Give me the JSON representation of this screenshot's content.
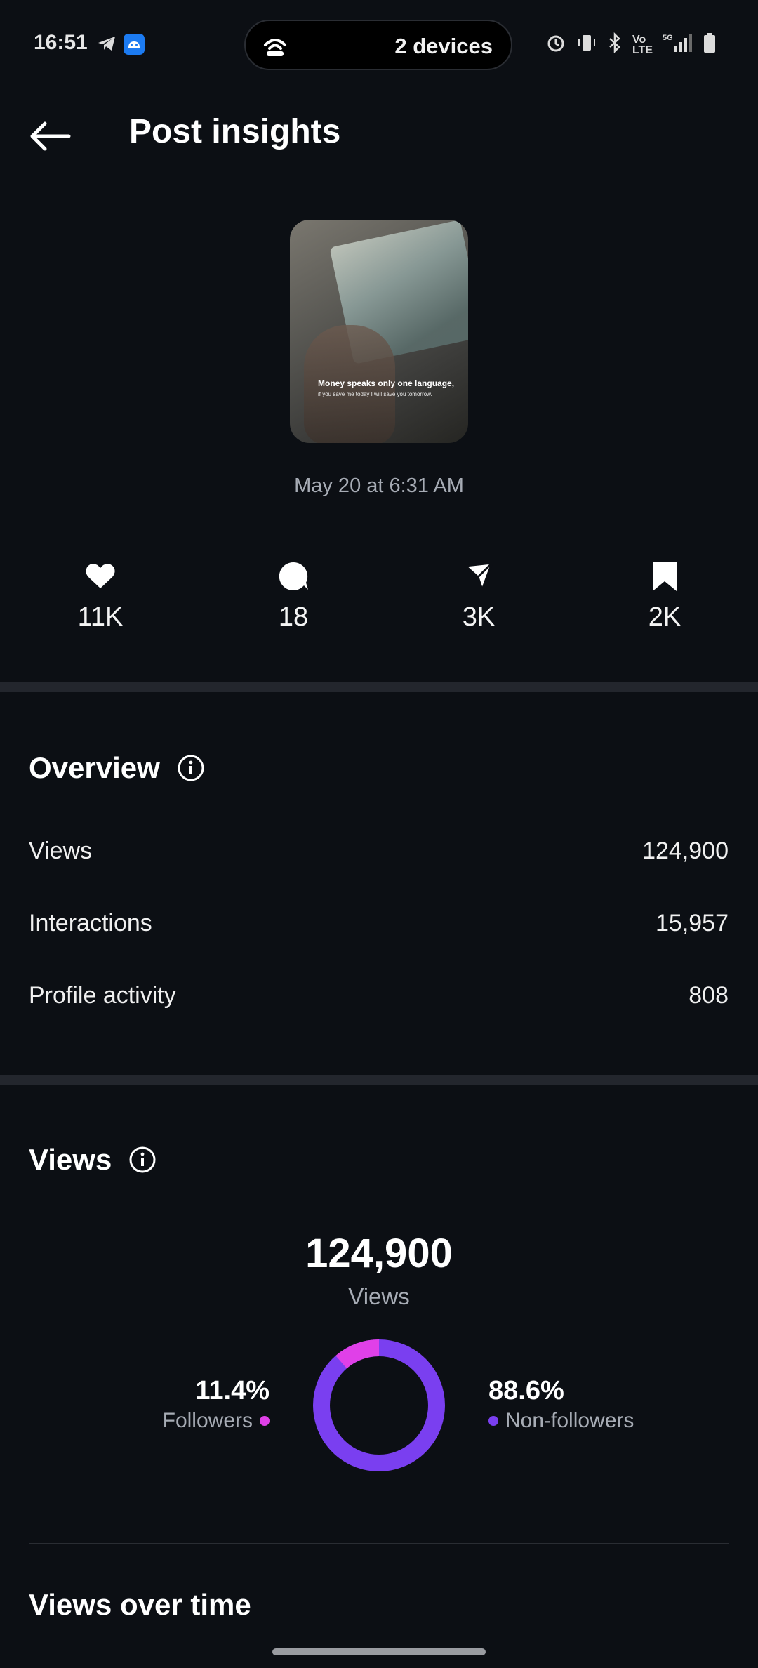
{
  "status_bar": {
    "time": "16:51",
    "center_pill": "2 devices",
    "icons": [
      "telegram-icon",
      "android-icon",
      "alarm-icon",
      "vibrate-icon",
      "bluetooth-icon",
      "volte-icon",
      "5g-signal-icon",
      "battery-icon"
    ]
  },
  "header": {
    "title": "Post insights"
  },
  "post": {
    "thumbnail_caption_1": "Money speaks only one language,",
    "thumbnail_caption_2": "if you save me today I will save you tomorrow.",
    "date": "May 20 at 6:31 AM"
  },
  "engagement": {
    "likes": "11K",
    "comments": "18",
    "shares": "3K",
    "saves": "2K"
  },
  "overview": {
    "title": "Overview",
    "rows": [
      {
        "label": "Views",
        "value": "124,900"
      },
      {
        "label": "Interactions",
        "value": "15,957"
      },
      {
        "label": "Profile activity",
        "value": "808"
      }
    ]
  },
  "views": {
    "title": "Views",
    "total": "124,900",
    "total_label": "Views",
    "followers_pct": "11.4%",
    "followers_label": "Followers",
    "nonfollowers_pct": "88.6%",
    "nonfollowers_label": "Non-followers",
    "followers_fraction": 0.114,
    "colors": {
      "followers": "#e040e8",
      "nonfollowers": "#7a3ff0"
    }
  },
  "views_over_time": {
    "title": "Views over time"
  }
}
